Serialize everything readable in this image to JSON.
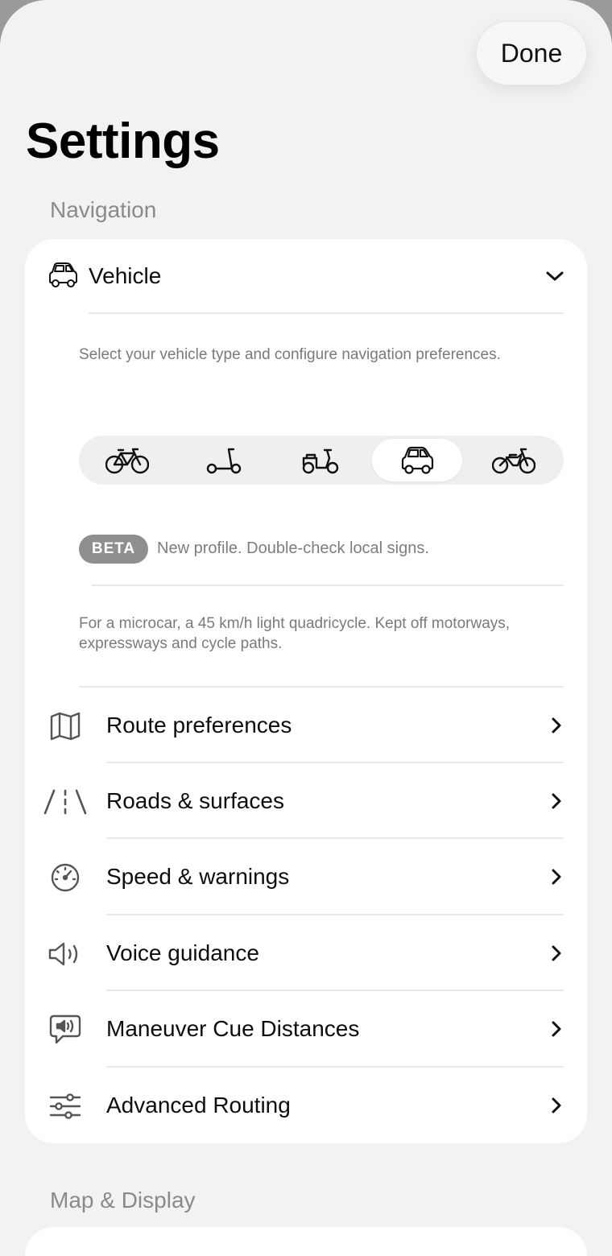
{
  "header": {
    "done_label": "Done",
    "title": "Settings"
  },
  "sections": {
    "navigation_label": "Navigation",
    "map_display_label": "Map & Display"
  },
  "vehicle": {
    "title": "Vehicle",
    "icon": "microcar-icon",
    "description": "Select your vehicle type and configure navigation preferences.",
    "types": [
      {
        "icon": "bicycle-icon",
        "selected": false
      },
      {
        "icon": "kick-scooter-icon",
        "selected": false
      },
      {
        "icon": "moped-icon",
        "selected": false
      },
      {
        "icon": "microcar-icon",
        "selected": true
      },
      {
        "icon": "motorcycle-icon",
        "selected": false
      }
    ],
    "beta_badge": "BETA",
    "beta_note": "New profile. Double-check local signs.",
    "profile_description": "For a microcar, a 45 km/h light quadricycle. Kept off motorways, expressways and cycle paths."
  },
  "menu": [
    {
      "label": "Route preferences",
      "icon": "map-icon"
    },
    {
      "label": "Roads & surfaces",
      "icon": "road-icon"
    },
    {
      "label": "Speed & warnings",
      "icon": "speedometer-icon"
    },
    {
      "label": "Voice guidance",
      "icon": "speaker-icon"
    },
    {
      "label": "Maneuver Cue Distances",
      "icon": "speech-bubble-speaker-icon"
    },
    {
      "label": "Advanced Routing",
      "icon": "sliders-icon"
    }
  ],
  "colors": {
    "background": "#f2f2f2",
    "card": "#ffffff",
    "muted_text": "#8a8a8a",
    "badge": "#8f8f8f"
  }
}
